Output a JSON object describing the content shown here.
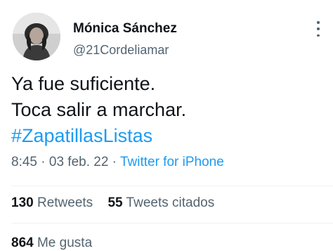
{
  "author": {
    "name": "Mónica Sánchez",
    "handle": "@21Cordeliamar"
  },
  "tweet": {
    "lines": [
      "Ya fue suficiente.",
      "Toca salir a marchar."
    ],
    "hashtag": "#ZapatillasListas"
  },
  "meta": {
    "time": "8:45",
    "separator1": " · ",
    "date": "03 feb. 22",
    "separator2": " · ",
    "source": "Twitter for iPhone"
  },
  "stats": {
    "retweets": {
      "count": "130",
      "label": "Retweets"
    },
    "quotes": {
      "count": "55",
      "label": "Tweets citados"
    },
    "likes": {
      "count": "864",
      "label": "Me gusta"
    }
  },
  "colors": {
    "text": "#0f1419",
    "secondary": "#536471",
    "accent": "#1d9bf0",
    "divider": "#eff3f4"
  },
  "icons": {
    "more": "more-vertical-icon"
  }
}
